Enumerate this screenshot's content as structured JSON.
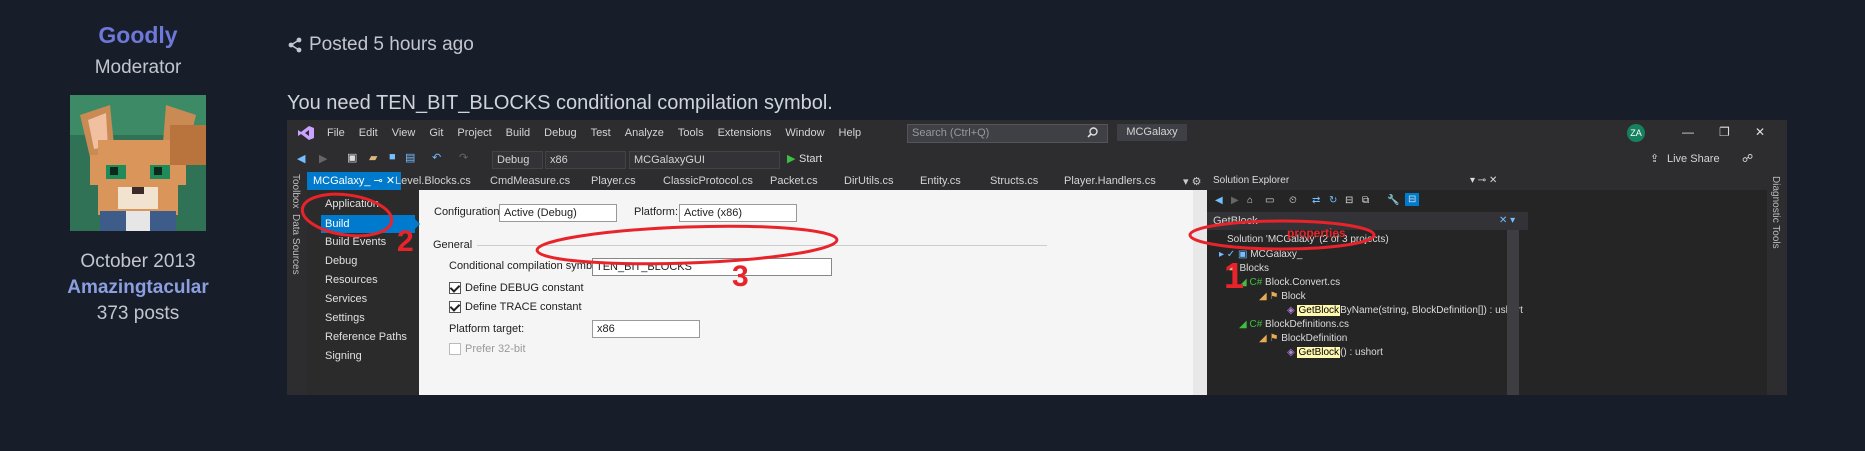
{
  "author": {
    "name": "Goodly",
    "role": "Moderator",
    "joined": "October 2013",
    "rank": "Amazingtacular",
    "posts": "373 posts"
  },
  "post": {
    "posted": "Posted 5 hours ago",
    "message": "You need TEN_BIT_BLOCKS conditional compilation symbol."
  },
  "vs": {
    "menu": [
      "File",
      "Edit",
      "View",
      "Git",
      "Project",
      "Build",
      "Debug",
      "Test",
      "Analyze",
      "Tools",
      "Extensions",
      "Window",
      "Help"
    ],
    "search_placeholder": "Search (Ctrl+Q)",
    "project_name": "MCGalaxy",
    "avatar": "ZA",
    "toolbar": {
      "config": "Debug",
      "platform": "x86",
      "startup": "MCGalaxyGUI",
      "start": "Start",
      "live_share": "Live Share"
    },
    "side_tools": [
      "Toolbox",
      "Data Sources"
    ],
    "right_tools": "Diagnostic Tools",
    "tabs": [
      "MCGalaxy_",
      "Level.Blocks.cs",
      "CmdMeasure.cs",
      "Player.cs",
      "ClassicProtocol.cs",
      "Packet.cs",
      "DirUtils.cs",
      "Entity.cs",
      "Structs.cs",
      "Player.Handlers.cs"
    ],
    "nav": [
      "Application",
      "Build",
      "Build Events",
      "Debug",
      "Resources",
      "Services",
      "Settings",
      "Reference Paths",
      "Signing"
    ],
    "props": {
      "config_label": "Configuration:",
      "config_value": "Active (Debug)",
      "platform_label": "Platform:",
      "platform_value": "Active (x86)",
      "general": "General",
      "symbols_label": "Conditional compilation symbols:",
      "symbols_value": "TEN_BIT_BLOCKS",
      "define_debug": "Define DEBUG constant",
      "define_trace": "Define TRACE constant",
      "target_label": "Platform target:",
      "target_value": "x86",
      "prefer32": "Prefer 32-bit"
    },
    "solution": {
      "title": "Solution Explorer",
      "search": "GetBlock",
      "rows": {
        "solution": "Solution 'MCGalaxy' (2 of 3 projects)",
        "project": "MCGalaxy_",
        "blocks": "Blocks",
        "convert": "Block.Convert.cs",
        "block": "Block",
        "method1": "GetBlock",
        "method1_rest": "ByName(string, BlockDefinition[]) : ushort",
        "defs": "BlockDefinitions.cs",
        "blockdef": "BlockDefinition",
        "method2": "GetBlock",
        "method2_rest": "() : ushort"
      }
    },
    "annotations": [
      "1",
      "2",
      "3",
      "properties"
    ]
  }
}
